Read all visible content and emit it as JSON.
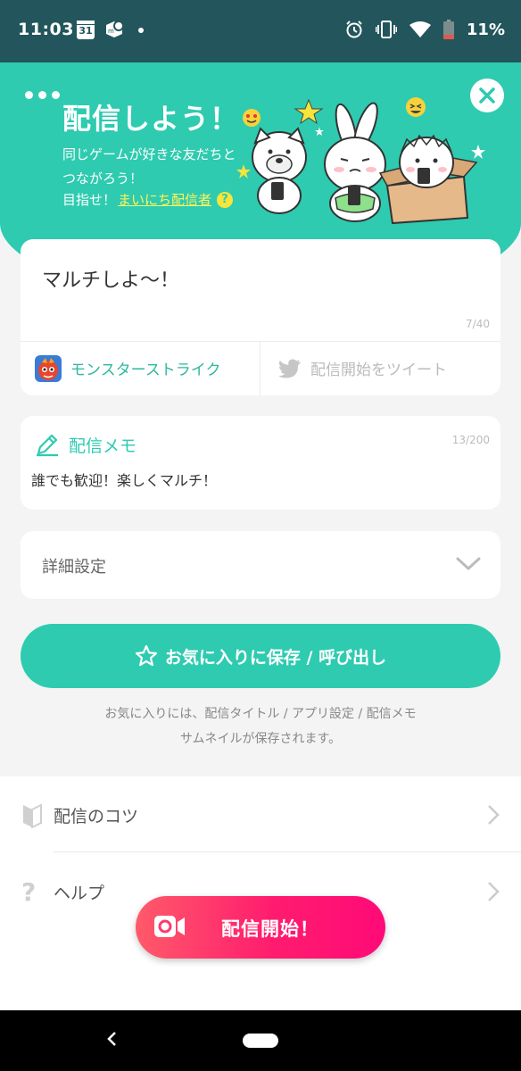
{
  "status_bar": {
    "time": "11:03",
    "calendar_day": "31",
    "battery": "11%",
    "icons": [
      "calendar-icon",
      "app-notification-icon",
      "dot-icon",
      "alarm-icon",
      "vibrate-icon",
      "wifi-icon",
      "battery-icon"
    ]
  },
  "header": {
    "title": "配信しよう！",
    "subtitle": "同じゲームが好きな友だちとつながろう！",
    "goal_prefix": "目指せ！",
    "goal_link": "まいにち配信者",
    "help_badge": "?"
  },
  "title_card": {
    "value": "マルチしよ〜！",
    "count": "7/40",
    "game_name": "モンスターストライク",
    "tweet_label": "配信開始をツイート"
  },
  "memo_card": {
    "label": "配信メモ",
    "count": "13/200",
    "text": "誰でも歓迎！楽しくマルチ！"
  },
  "detail": {
    "label": "詳細設定"
  },
  "favorite": {
    "button_label": "お気に入りに保存 / 呼び出し",
    "note_line1": "お気に入りには、配信タイトル / アプリ設定 / 配信メモ",
    "note_line2": "サムネイルが保存されます。"
  },
  "list": {
    "tips_label": "配信のコツ",
    "help_label": "ヘルプ"
  },
  "start": {
    "label": "配信開始！"
  },
  "colors": {
    "teal": "#2ecbb0",
    "status_bar": "#23565c",
    "start_gradient_from": "#ff5a6a",
    "start_gradient_to": "#ff0a78",
    "goal_link": "#fff35a"
  }
}
